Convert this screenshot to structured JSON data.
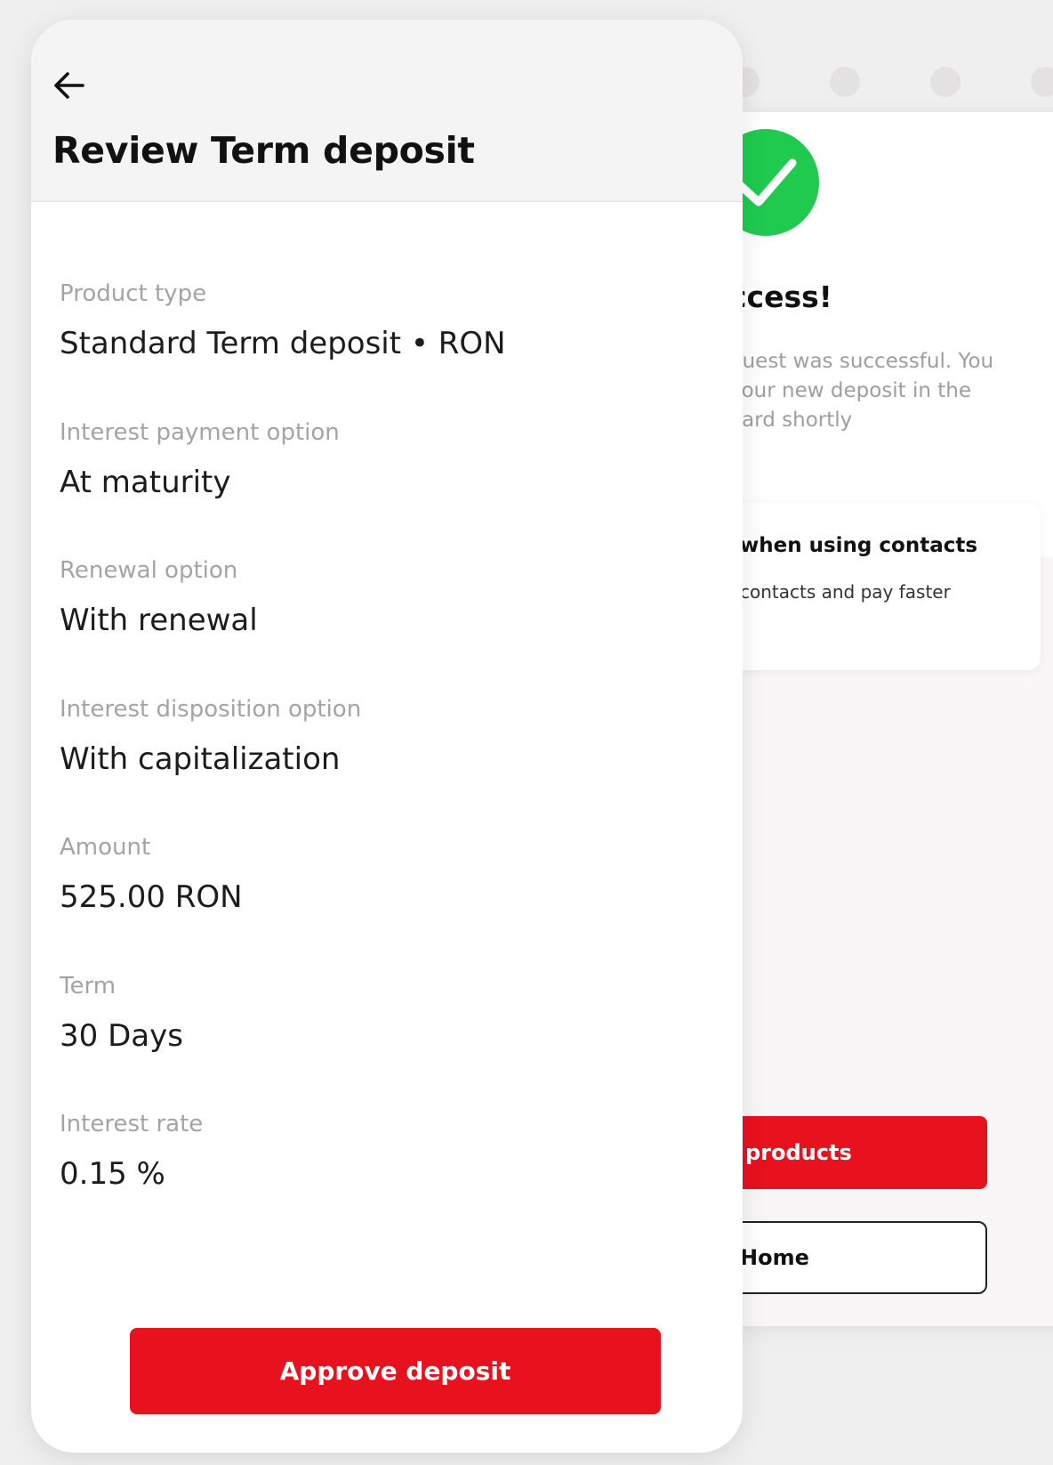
{
  "review": {
    "title": "Review Term deposit",
    "fields": [
      {
        "label": "Product type",
        "value": "Standard Term deposit • RON"
      },
      {
        "label": "Interest payment option",
        "value": "At maturity"
      },
      {
        "label": "Renewal option",
        "value": "With renewal"
      },
      {
        "label": "Interest disposition option",
        "value": "With capitalization"
      },
      {
        "label": "Amount",
        "value": "525.00 RON"
      },
      {
        "label": "Term",
        "value": "30 Days"
      },
      {
        "label": "Interest rate",
        "value": "0.15 %"
      }
    ],
    "approve_label": "Approve deposit"
  },
  "success_screen": {
    "title": "ccess!",
    "message": "quest was successful. You your new deposit in the oard shortly",
    "contacts_title": "when using contacts",
    "contacts_subtitle": "contacts and pay faster",
    "products_label": "products",
    "home_label": "Home"
  },
  "colors": {
    "accent_red": "#e8111e",
    "success_green": "#1fca4f"
  },
  "icons": {
    "back": "arrow-left-icon",
    "success": "check-circle-icon"
  }
}
